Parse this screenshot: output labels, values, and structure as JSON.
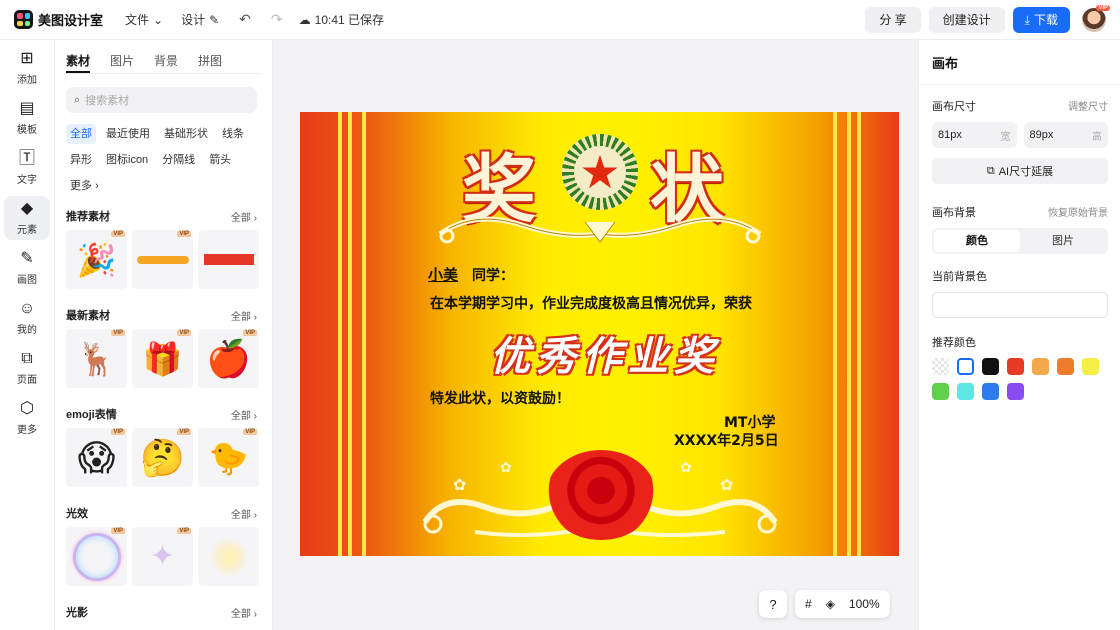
{
  "topbar": {
    "app_name": "美图设计室",
    "menu_file": "文件",
    "menu_design": "设计",
    "save_status": "10:41 已保存",
    "share_label": "分 享",
    "create_label": "创建设计",
    "download_label": "下载",
    "avatar_badge": "VIP"
  },
  "leftnav": [
    {
      "label": "添加",
      "icon": "plus-square-icon"
    },
    {
      "label": "模板",
      "icon": "template-icon"
    },
    {
      "label": "文字",
      "icon": "text-icon"
    },
    {
      "label": "元素",
      "icon": "element-icon"
    },
    {
      "label": "画图",
      "icon": "draw-icon"
    },
    {
      "label": "我的",
      "icon": "user-icon"
    },
    {
      "label": "页面",
      "icon": "page-icon"
    },
    {
      "label": "更多",
      "icon": "cube-icon"
    }
  ],
  "panel": {
    "tabs": [
      "素材",
      "图片",
      "背景",
      "拼图"
    ],
    "search_placeholder": "搜索素材",
    "chips": [
      "全部",
      "最近使用",
      "基础形状",
      "线条",
      "异形",
      "图标icon",
      "分隔线",
      "箭头",
      "更多"
    ],
    "see_all": "全部",
    "vip": "VIP",
    "sections": [
      {
        "title": "推荐素材",
        "items": [
          "🎉",
          "",
          ""
        ]
      },
      {
        "title": "最新素材",
        "items": [
          "🦌",
          "🎁",
          "🍎"
        ]
      },
      {
        "title": "emoji表情",
        "items": [
          "😱",
          "🤔",
          "🐤"
        ]
      },
      {
        "title": "光效",
        "items": [
          "",
          "",
          ""
        ]
      },
      {
        "title": "光影",
        "items": []
      }
    ]
  },
  "certificate": {
    "title_left": "奖",
    "title_right": "状",
    "star": "★",
    "name": "小美",
    "greeting": "同学：",
    "line1": "在本学期学习中，作业完成度极高且情况优异，荣获",
    "award": "优秀作业奖",
    "line2": "特发此状，以资鼓励！",
    "school": "MT小学",
    "date": "XXXX年2月5日"
  },
  "canvas_tools": {
    "help": "?",
    "zoom": "100%"
  },
  "rightpanel": {
    "title": "画布",
    "size_label": "画布尺寸",
    "size_adjust": "调整尺寸",
    "width_value": "81px",
    "width_unit": "宽",
    "height_value": "89px",
    "height_unit": "高",
    "ai_extend": "AI尺寸延展",
    "bg_label": "画布背景",
    "bg_restore": "恢复原始背景",
    "seg_color": "颜色",
    "seg_image": "图片",
    "current_bg": "当前背景色",
    "recommend": "推荐颜色",
    "swatches": [
      "transparent",
      "#ffffff",
      "#111111",
      "#e83b25",
      "#f3a94b",
      "#ee7d2b",
      "#f5ee47",
      "#5fcf4c",
      "#5ee6e3",
      "#2c7bef",
      "#8a4cf0"
    ]
  },
  "colors": {
    "accent": "#1a6cf6",
    "cert_red": "#e83a17",
    "cert_yellow": "#fff100"
  }
}
